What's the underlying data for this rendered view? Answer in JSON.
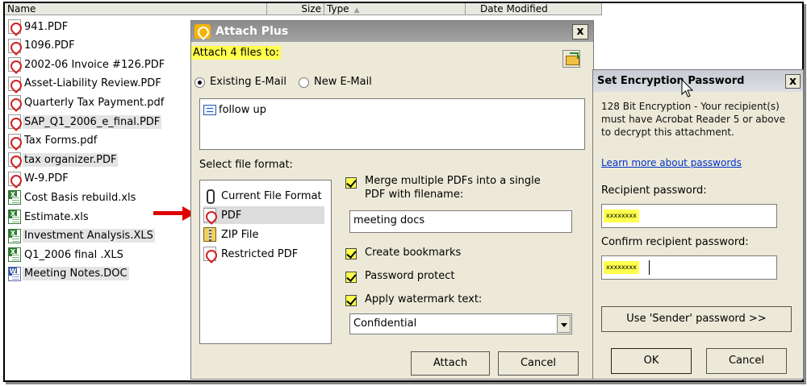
{
  "explorer": {
    "columns": [
      {
        "label": "Name"
      },
      {
        "label": "Size"
      },
      {
        "label": "Type"
      },
      {
        "label": "Date Modified"
      }
    ],
    "files": [
      {
        "name": "941.PDF",
        "icon": "pdf-icon",
        "selected": false
      },
      {
        "name": "1096.PDF",
        "icon": "pdf-icon",
        "selected": false
      },
      {
        "name": "2002-06 Invoice #126.PDF",
        "icon": "pdf-icon",
        "selected": false
      },
      {
        "name": "Asset-Liability Review.PDF",
        "icon": "pdf-icon",
        "selected": false
      },
      {
        "name": "Quarterly Tax Payment.pdf",
        "icon": "pdf-icon",
        "selected": false
      },
      {
        "name": "SAP_Q1_2006_e_final.PDF",
        "icon": "pdf-icon",
        "selected": true
      },
      {
        "name": "Tax Forms.pdf",
        "icon": "pdf-icon",
        "selected": false
      },
      {
        "name": "tax organizer.PDF",
        "icon": "pdf-icon",
        "selected": true
      },
      {
        "name": "W-9.PDF",
        "icon": "pdf-icon",
        "selected": false
      },
      {
        "name": "Cost Basis rebuild.xls",
        "icon": "excel-icon",
        "selected": false
      },
      {
        "name": "Estimate.xls",
        "icon": "excel-icon",
        "selected": false
      },
      {
        "name": "Investment Analysis.XLS",
        "icon": "excel-icon",
        "selected": true
      },
      {
        "name": "Q1_2006 final .XLS",
        "icon": "excel-icon",
        "selected": false
      },
      {
        "name": "Meeting Notes.DOC",
        "icon": "word-icon",
        "selected": true
      }
    ]
  },
  "attach_dialog": {
    "title": "Attach Plus",
    "close_label": "x",
    "attach_count_label": "Attach 4 files to:",
    "radio_existing": "Existing E-Mail",
    "radio_new": "New E-Mail",
    "selected_radio": "existing",
    "email_item": "follow up",
    "select_format_label": "Select file format:",
    "formats": [
      {
        "label": "Current File Format",
        "icon": "paperclip-icon",
        "selected": false
      },
      {
        "label": "PDF",
        "icon": "pdf-icon",
        "selected": true
      },
      {
        "label": "ZIP File",
        "icon": "zip-icon",
        "selected": false
      },
      {
        "label": "Restricted PDF",
        "icon": "pdf-icon",
        "selected": false
      }
    ],
    "merge_label_line1": "Merge multiple PDFs into a single",
    "merge_label_line2": "PDF with filename:",
    "merge_checked": true,
    "filename_value": "meeting docs",
    "create_bookmarks_label": "Create bookmarks",
    "create_bookmarks_checked": true,
    "password_protect_label": "Password protect",
    "password_protect_checked": true,
    "watermark_label": "Apply watermark text:",
    "watermark_checked": true,
    "watermark_value": "Confidential",
    "attach_button": "Attach",
    "cancel_button": "Cancel",
    "highlight_color": "#ffff4d",
    "titlebar_color": "#9a9a9a"
  },
  "encryption_dialog": {
    "title": "Set Encryption Password",
    "close_label": "x",
    "description": "128 Bit Encryption - Your recipient(s) must have Acrobat Reader 5 or above to decrypt this attachment.",
    "learn_more_link": "Learn more about passwords",
    "recipient_password_label": "Recipient password:",
    "recipient_password_value": "xxxxxxxx",
    "confirm_password_label": "Confirm recipient password:",
    "confirm_password_value": "xxxxxxxx",
    "sender_password_button": "Use 'Sender' password >>",
    "ok_button": "OK",
    "cancel_button": "Cancel",
    "link_color": "#0033cc"
  }
}
